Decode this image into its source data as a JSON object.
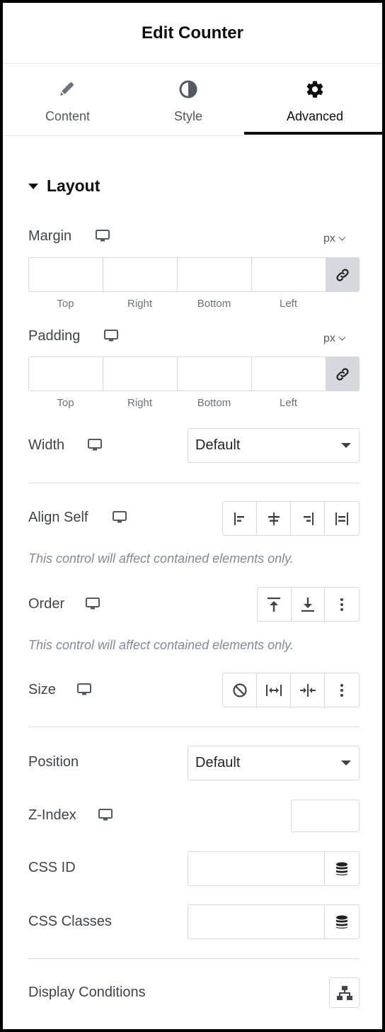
{
  "header": {
    "title": "Edit Counter"
  },
  "tabs": [
    {
      "label": "Content",
      "icon": "pencil-icon"
    },
    {
      "label": "Style",
      "icon": "contrast-icon"
    },
    {
      "label": "Advanced",
      "icon": "gear-icon",
      "active": true
    }
  ],
  "section": {
    "title": "Layout"
  },
  "margin": {
    "label": "Margin",
    "unit": "px",
    "sublabels": [
      "Top",
      "Right",
      "Bottom",
      "Left"
    ]
  },
  "padding": {
    "label": "Padding",
    "unit": "px",
    "sublabels": [
      "Top",
      "Right",
      "Bottom",
      "Left"
    ]
  },
  "width": {
    "label": "Width",
    "value": "Default"
  },
  "align_self": {
    "label": "Align Self",
    "note": "This control will affect contained elements only."
  },
  "order": {
    "label": "Order",
    "note": "This control will affect contained elements only."
  },
  "size": {
    "label": "Size"
  },
  "position": {
    "label": "Position",
    "value": "Default"
  },
  "z_index": {
    "label": "Z-Index"
  },
  "css_id": {
    "label": "CSS ID"
  },
  "css_classes": {
    "label": "CSS Classes"
  },
  "display_conditions": {
    "label": "Display Conditions"
  },
  "colors": {
    "accent": "#0c0d0e",
    "border": "#d5d8dc",
    "text": "#3f444b",
    "muted": "#818a96",
    "link_bg": "#d5d8dc"
  }
}
